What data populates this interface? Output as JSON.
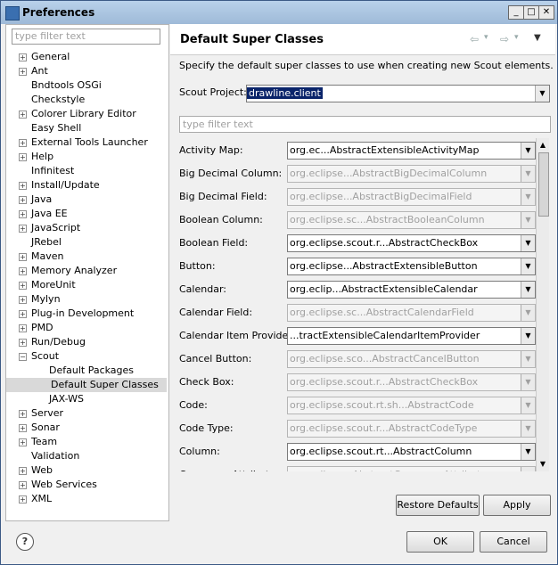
{
  "window": {
    "title": "Preferences",
    "minimize": "_",
    "maximize": "□",
    "close": "✕"
  },
  "left": {
    "filter_placeholder": "type filter text",
    "tree": [
      {
        "label": "General",
        "expander": "+",
        "indent": 0
      },
      {
        "label": "Ant",
        "expander": "+",
        "indent": 0
      },
      {
        "label": "Bndtools OSGi",
        "expander": "",
        "indent": 0
      },
      {
        "label": "Checkstyle",
        "expander": "",
        "indent": 0
      },
      {
        "label": "Colorer Library Editor",
        "expander": "+",
        "indent": 0
      },
      {
        "label": "Easy Shell",
        "expander": "",
        "indent": 0
      },
      {
        "label": "External Tools Launcher",
        "expander": "+",
        "indent": 0
      },
      {
        "label": "Help",
        "expander": "+",
        "indent": 0
      },
      {
        "label": "Infinitest",
        "expander": "",
        "indent": 0
      },
      {
        "label": "Install/Update",
        "expander": "+",
        "indent": 0
      },
      {
        "label": "Java",
        "expander": "+",
        "indent": 0
      },
      {
        "label": "Java EE",
        "expander": "+",
        "indent": 0
      },
      {
        "label": "JavaScript",
        "expander": "+",
        "indent": 0
      },
      {
        "label": "JRebel",
        "expander": "",
        "indent": 0
      },
      {
        "label": "Maven",
        "expander": "+",
        "indent": 0
      },
      {
        "label": "Memory Analyzer",
        "expander": "+",
        "indent": 0
      },
      {
        "label": "MoreUnit",
        "expander": "+",
        "indent": 0
      },
      {
        "label": "Mylyn",
        "expander": "+",
        "indent": 0
      },
      {
        "label": "Plug-in Development",
        "expander": "+",
        "indent": 0
      },
      {
        "label": "PMD",
        "expander": "+",
        "indent": 0
      },
      {
        "label": "Run/Debug",
        "expander": "+",
        "indent": 0
      },
      {
        "label": "Scout",
        "expander": "−",
        "indent": 0
      },
      {
        "label": "Default Packages",
        "expander": "",
        "indent": 1
      },
      {
        "label": "Default Super Classes",
        "expander": "",
        "indent": 1,
        "selected": true
      },
      {
        "label": "JAX-WS",
        "expander": "",
        "indent": 1
      },
      {
        "label": "Server",
        "expander": "+",
        "indent": 0
      },
      {
        "label": "Sonar",
        "expander": "+",
        "indent": 0
      },
      {
        "label": "Team",
        "expander": "+",
        "indent": 0
      },
      {
        "label": "Validation",
        "expander": "",
        "indent": 0
      },
      {
        "label": "Web",
        "expander": "+",
        "indent": 0
      },
      {
        "label": "Web Services",
        "expander": "+",
        "indent": 0
      },
      {
        "label": "XML",
        "expander": "+",
        "indent": 0
      }
    ]
  },
  "right": {
    "title": "Default Super Classes",
    "nav_back": "⇦",
    "nav_back_menu": "▾",
    "nav_forward": "⇨",
    "nav_forward_menu": "▾",
    "nav_menu": "▼",
    "description": "Specify the default super classes to use when creating new Scout elements.",
    "project_label": "Scout Project:",
    "project_value": "drawline.client",
    "filter_placeholder": "type filter text",
    "rows": [
      {
        "label": "Activity Map:",
        "value": "org.ec...AbstractExtensibleActivityMap",
        "enabled": true
      },
      {
        "label": "Big Decimal Column:",
        "value": "org.eclipse...AbstractBigDecimalColumn",
        "enabled": false
      },
      {
        "label": "Big Decimal Field:",
        "value": "org.eclipse...AbstractBigDecimalField",
        "enabled": false
      },
      {
        "label": "Boolean Column:",
        "value": "org.eclipse.sc...AbstractBooleanColumn",
        "enabled": false
      },
      {
        "label": "Boolean Field:",
        "value": "org.eclipse.scout.r...AbstractCheckBox",
        "enabled": true
      },
      {
        "label": "Button:",
        "value": "org.eclipse...AbstractExtensibleButton",
        "enabled": true
      },
      {
        "label": "Calendar:",
        "value": "org.eclip...AbstractExtensibleCalendar",
        "enabled": true
      },
      {
        "label": "Calendar Field:",
        "value": "org.eclipse.sc...AbstractCalendarField",
        "enabled": false
      },
      {
        "label": "Calendar Item Provider:",
        "value": "...tractExtensibleCalendarItemProvider",
        "enabled": true
      },
      {
        "label": "Cancel Button:",
        "value": "org.eclipse.sco...AbstractCancelButton",
        "enabled": false
      },
      {
        "label": "Check Box:",
        "value": "org.eclipse.scout.r...AbstractCheckBox",
        "enabled": false
      },
      {
        "label": "Code:",
        "value": "org.eclipse.scout.rt.sh...AbstractCode",
        "enabled": false
      },
      {
        "label": "Code Type:",
        "value": "org.eclipse.scout.r...AbstractCodeType",
        "enabled": false
      },
      {
        "label": "Column:",
        "value": "org.eclipse.scout.rt...AbstractColumn",
        "enabled": true
      },
      {
        "label": "Composer Attribute:",
        "value": "org.eclipse...AbstractComposerAttribute",
        "enabled": false
      }
    ],
    "scroll_up": "▲",
    "scroll_down": "▼",
    "combo_arrow": "▼",
    "restore_defaults": "Restore Defaults",
    "apply": "Apply"
  },
  "footer": {
    "help": "?",
    "ok": "OK",
    "cancel": "Cancel"
  }
}
